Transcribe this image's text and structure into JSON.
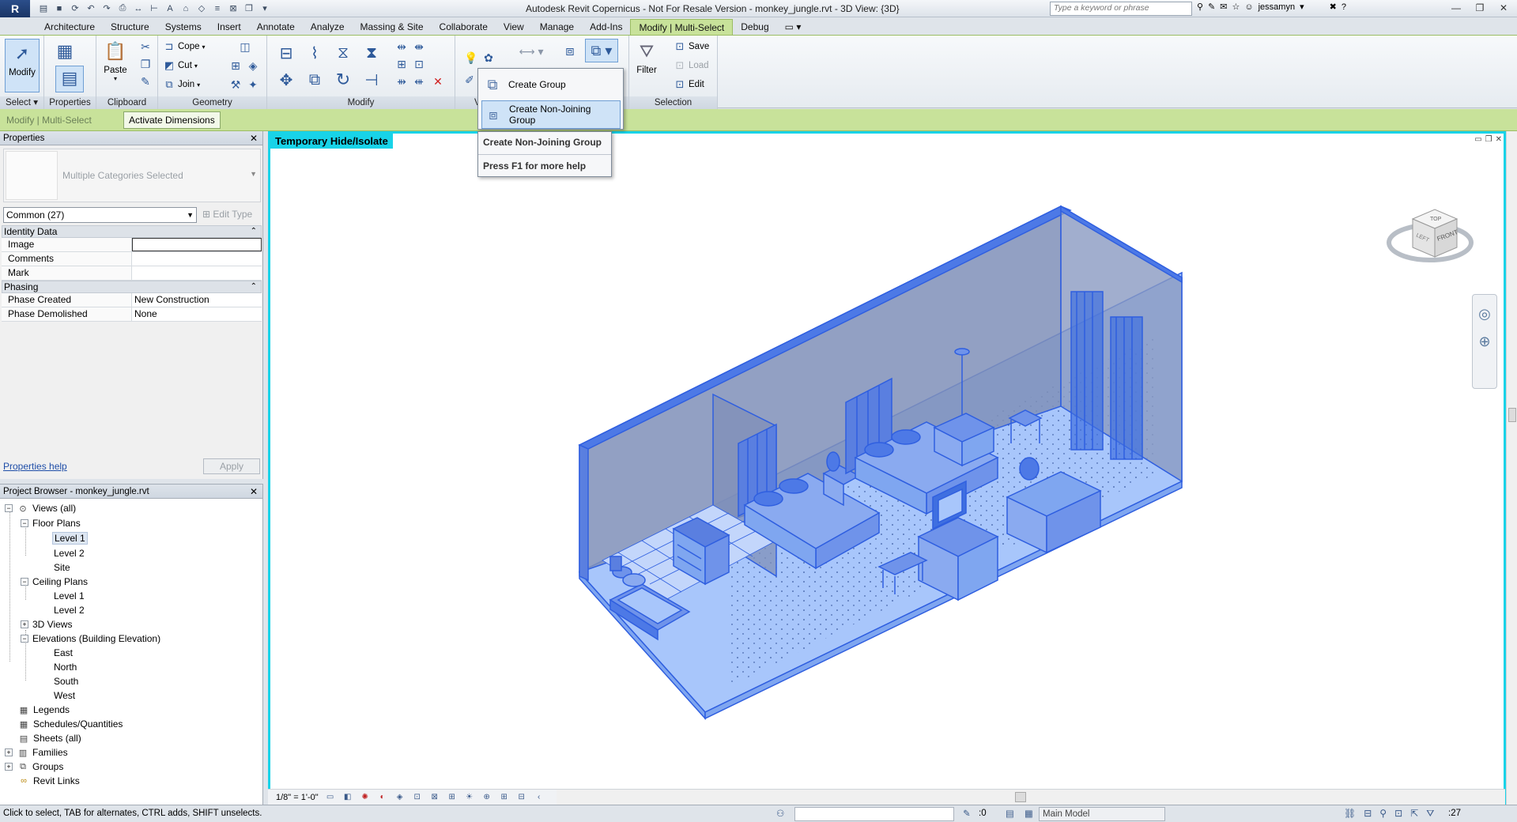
{
  "app": {
    "title": "Autodesk Revit Copernicus - Not For Resale Version -    monkey_jungle.rvt - 3D View: {3D}",
    "search_placeholder": "Type a keyword or phrase",
    "user": "jessamyn",
    "app_button": "R"
  },
  "tabs": [
    {
      "label": "Architecture"
    },
    {
      "label": "Structure"
    },
    {
      "label": "Systems"
    },
    {
      "label": "Insert"
    },
    {
      "label": "Annotate"
    },
    {
      "label": "Analyze"
    },
    {
      "label": "Massing & Site"
    },
    {
      "label": "Collaborate"
    },
    {
      "label": "View"
    },
    {
      "label": "Manage"
    },
    {
      "label": "Add-Ins"
    },
    {
      "label": "Modify | Multi-Select"
    },
    {
      "label": "Debug"
    }
  ],
  "ribbon": {
    "select": {
      "button": "Modify",
      "label": "Select"
    },
    "properties": {
      "label": "Properties"
    },
    "clipboard": {
      "paste": "Paste",
      "label": "Clipboard"
    },
    "geometry": {
      "cope": "Cope",
      "cut": "Cut",
      "join": "Join",
      "label": "Geometry"
    },
    "modify": {
      "label": "Modify"
    },
    "view_partial": {
      "label": "V"
    },
    "selection": {
      "filter": "Filter",
      "save": "Save",
      "load": "Load",
      "edit": "Edit",
      "label": "Selection"
    }
  },
  "optbar": {
    "context": "Modify | Multi-Select",
    "activate_dimensions": "Activate Dimensions"
  },
  "dropdown": {
    "create_group": "Create Group",
    "create_non_joining_group": "Create Non-Joining Group"
  },
  "tooltip": {
    "title": "Create Non-Joining Group",
    "help": "Press F1 for more help"
  },
  "properties": {
    "header": "Properties",
    "type_name": "Multiple Categories Selected",
    "filter": "Common (27)",
    "edit_type": "Edit Type",
    "groups": [
      {
        "name": "Identity Data",
        "rows": [
          {
            "name": "Image",
            "value": ""
          },
          {
            "name": "Comments",
            "value": ""
          },
          {
            "name": "Mark",
            "value": ""
          }
        ]
      },
      {
        "name": "Phasing",
        "rows": [
          {
            "name": "Phase Created",
            "value": "New Construction"
          },
          {
            "name": "Phase Demolished",
            "value": "None"
          }
        ]
      }
    ],
    "help_link": "Properties help",
    "apply": "Apply"
  },
  "browser": {
    "header": "Project Browser - monkey_jungle.rvt",
    "tree": {
      "views_all": "Views (all)",
      "floor_plans": "Floor Plans",
      "fp_level1": "Level 1",
      "fp_level2": "Level 2",
      "fp_site": "Site",
      "ceiling_plans": "Ceiling Plans",
      "cp_level1": "Level 1",
      "cp_level2": "Level 2",
      "views_3d": "3D Views",
      "elevations": "Elevations (Building Elevation)",
      "east": "East",
      "north": "North",
      "south": "South",
      "west": "West",
      "legends": "Legends",
      "schedules": "Schedules/Quantities",
      "sheets": "Sheets (all)",
      "families": "Families",
      "groups": "Groups",
      "revit_links": "Revit Links"
    }
  },
  "view": {
    "label": "Temporary Hide/Isolate",
    "scale": "1/8\" = 1'-0\"",
    "viewcube": {
      "top": "TOP",
      "front": "FRONT",
      "left": "LEFT"
    }
  },
  "status": {
    "message": "Click to select, TAB for alternates, CTRL adds, SHIFT unselects.",
    "coord": ":0",
    "model": "Main Model",
    "selection_count": ":27"
  },
  "colors": {
    "isolate_border": "#18d3e8",
    "contextual_tab": "#c8e29a",
    "selection_blue": "#2f5fe0"
  }
}
